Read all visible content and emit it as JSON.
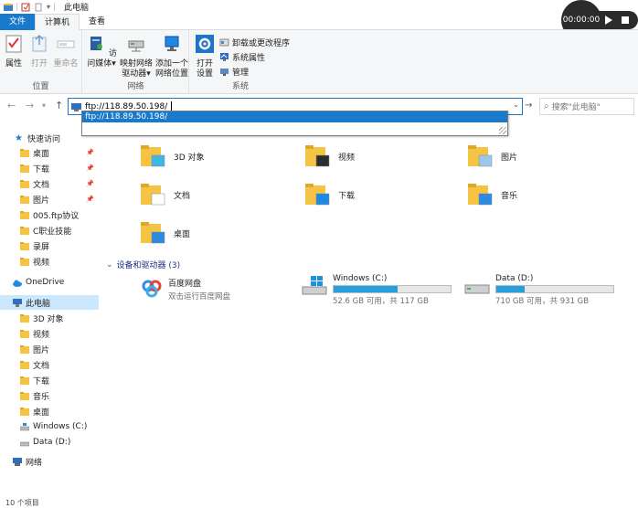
{
  "window": {
    "title": "此电脑"
  },
  "tabs": {
    "file": "文件",
    "computer": "计算机",
    "view": "查看"
  },
  "ribbon": {
    "location": {
      "label": "位置",
      "properties": "属性",
      "open": "打开",
      "rename": "重命名"
    },
    "network": {
      "label": "网络",
      "access_media_1": "访问媒体",
      "map_drive_1": "映射网络",
      "map_drive_2": "驱动器",
      "add_location_1": "添加一个",
      "add_location_2": "网络位置"
    },
    "system": {
      "label": "系统",
      "open_settings_1": "打开",
      "open_settings_2": "设置",
      "uninstall": "卸载或更改程序",
      "system_properties": "系统属性",
      "manage": "管理"
    }
  },
  "recorder": {
    "time": "00:00:00"
  },
  "address": {
    "value": "ftp://118.89.50.198/",
    "suggestion": "ftp://118.89.50.198/"
  },
  "search": {
    "placeholder": "搜索\"此电脑\""
  },
  "sidebar": {
    "quick_access": "快速访问",
    "qa_items": [
      "桌面",
      "下载",
      "文档",
      "图片",
      "005.ftp协议",
      "C职业技能",
      "录屏",
      "视频"
    ],
    "onedrive": "OneDrive",
    "this_pc": "此电脑",
    "pc_items": [
      "3D 对象",
      "视频",
      "图片",
      "文档",
      "下载",
      "音乐",
      "桌面",
      "Windows (C:)",
      "Data (D:)"
    ],
    "network": "网络"
  },
  "folders": [
    "3D 对象",
    "视频",
    "图片",
    "文档",
    "下载",
    "音乐",
    "桌面"
  ],
  "devices": {
    "header": "设备和驱动器 (3)",
    "baidu": {
      "name": "百度网盘",
      "sub": "双击运行百度网盘"
    },
    "c_drive": {
      "name": "Windows (C:)",
      "free": "52.6 GB 可用，共 117 GB",
      "used_fraction": 0.55
    },
    "d_drive": {
      "name": "Data (D:)",
      "free": "710 GB 可用，共 931 GB",
      "used_fraction": 0.24
    }
  },
  "status": {
    "items": "10 个项目"
  },
  "colors": {
    "accent": "#1979ca",
    "folder": "#f6c444",
    "drive_fill": "#26a0da"
  }
}
